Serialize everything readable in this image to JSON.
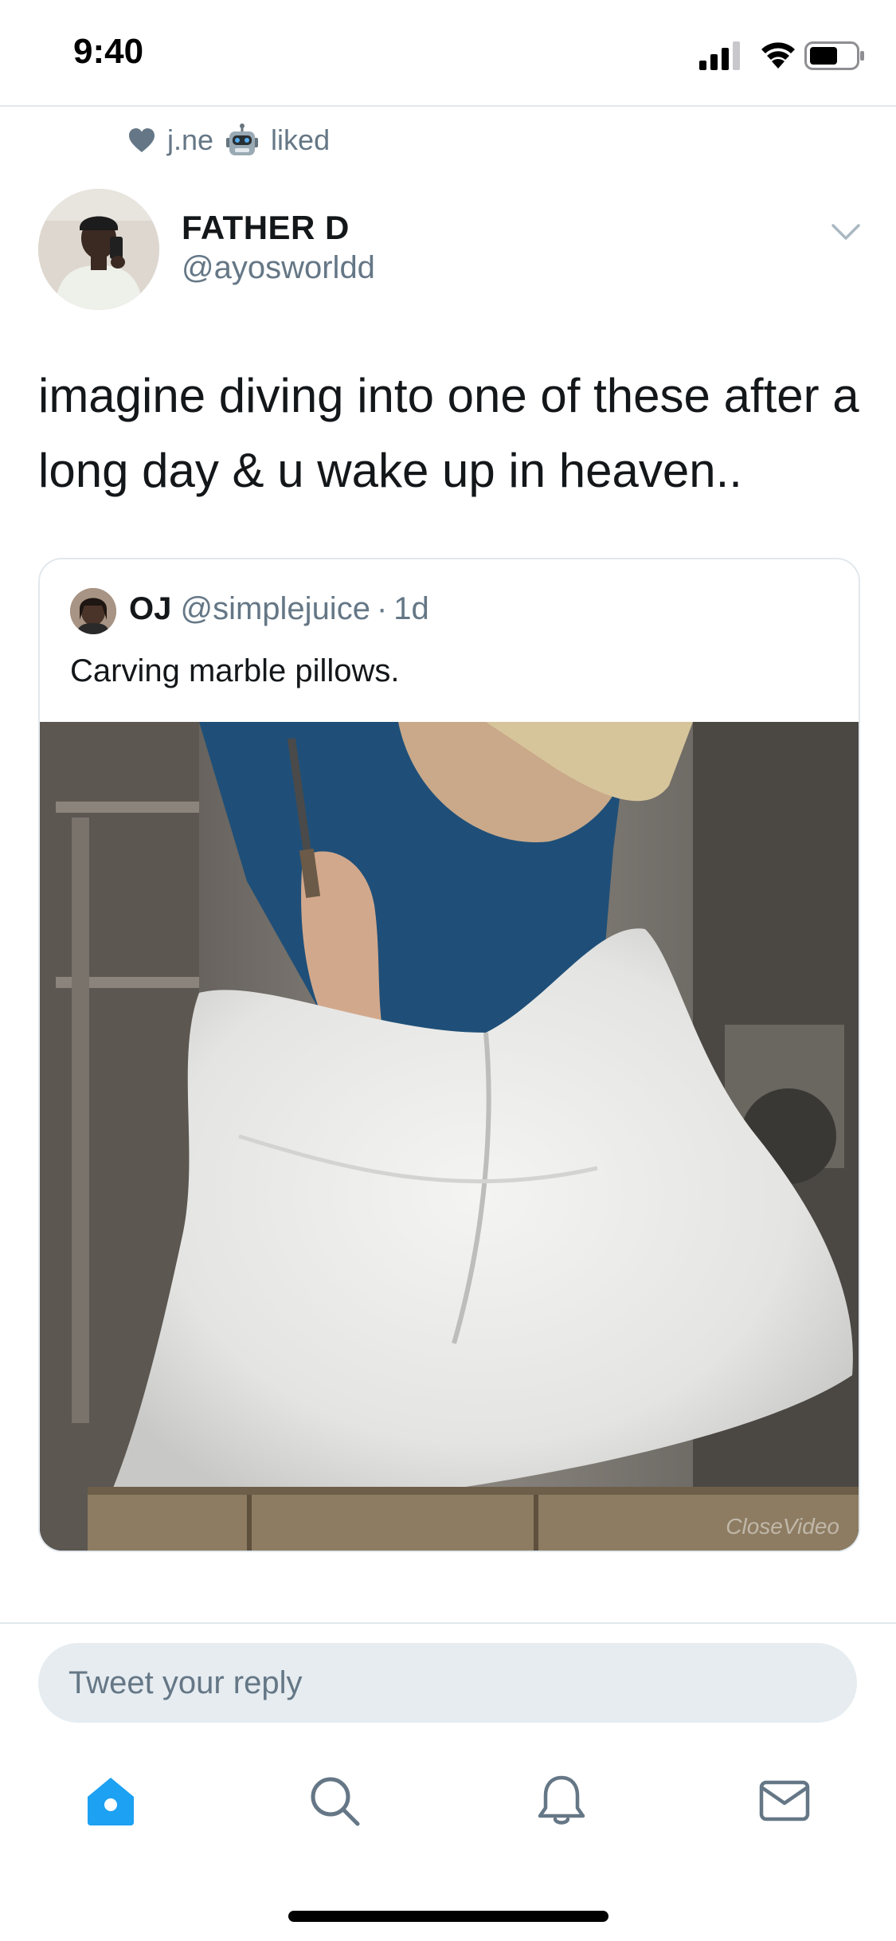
{
  "status_bar": {
    "time": "9:40"
  },
  "social_context": {
    "liker_name": "j.ne",
    "liked_label": "liked"
  },
  "tweet": {
    "display_name": "FATHER D",
    "username": "@ayosworldd",
    "text": "imagine diving into one of these after a long day & u wake up in heaven.."
  },
  "quoted_tweet": {
    "display_name": "OJ",
    "username": "@simplejuice",
    "separator": "·",
    "time_ago": "1d",
    "text": "Carving marble pillows.",
    "media_watermark": "CloseVideo"
  },
  "reply_bar": {
    "placeholder": "Tweet your reply"
  },
  "tab_bar": {
    "items": [
      "home-icon",
      "search-icon",
      "notifications-icon",
      "messages-icon"
    ],
    "active": "home-icon",
    "active_color": "#1da1f2",
    "inactive_color": "#657786"
  },
  "colors": {
    "accent": "#1da1f2",
    "secondary_text": "#657786",
    "border": "#e1e8ed"
  }
}
